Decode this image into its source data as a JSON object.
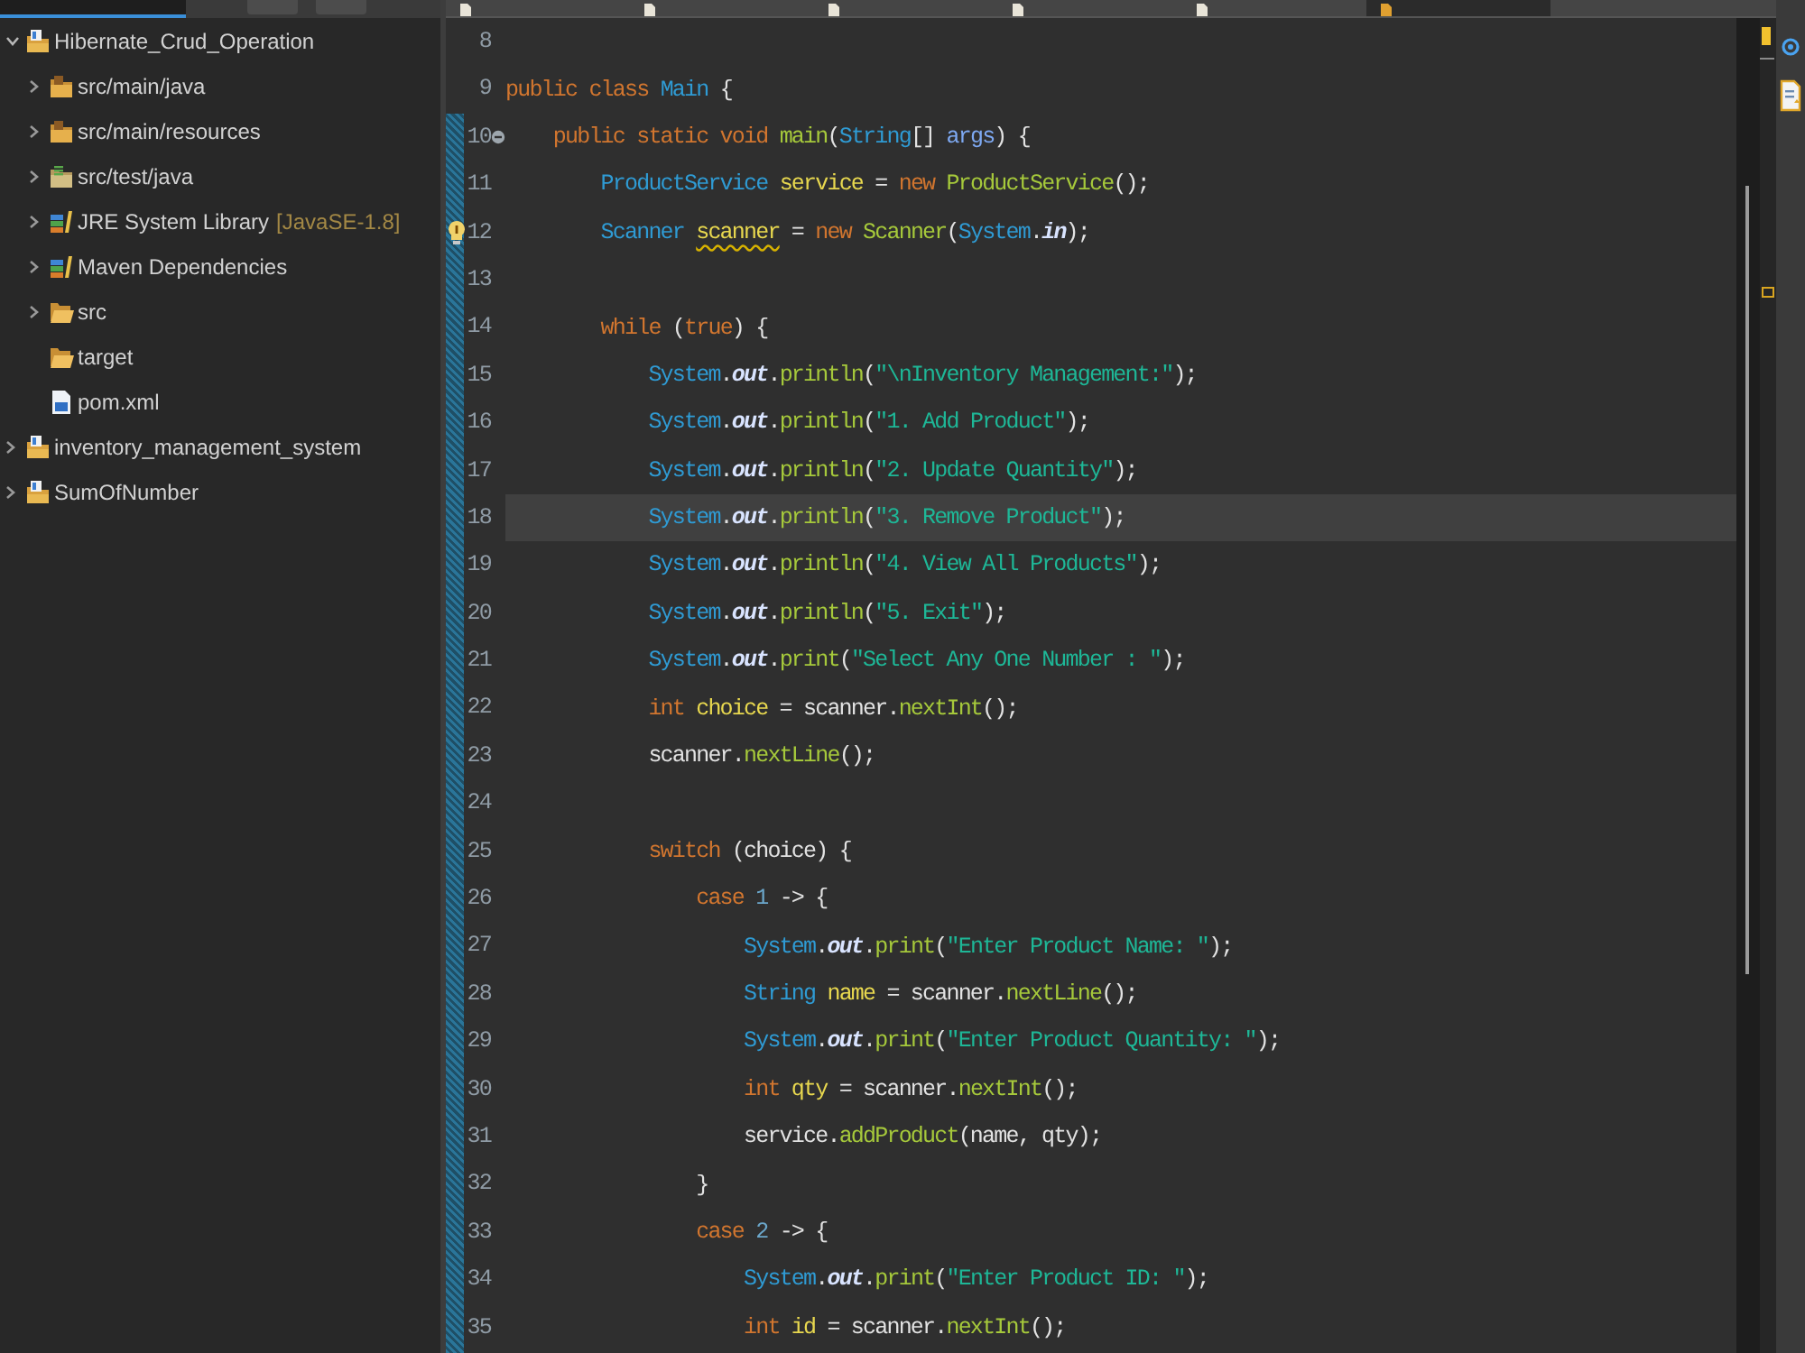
{
  "view_tabs": [
    {
      "selected": true
    }
  ],
  "project_tree": [
    {
      "name": "Hibernate_Crud_Operation",
      "kind": "project",
      "expandable": true,
      "expanded": true,
      "children": [
        {
          "name": "src/main/java",
          "kind": "source-folder",
          "expandable": true,
          "expanded": false
        },
        {
          "name": "src/main/resources",
          "kind": "source-folder",
          "expandable": true,
          "expanded": false
        },
        {
          "name": "src/test/java",
          "kind": "test-folder",
          "expandable": true,
          "expanded": false
        },
        {
          "name": "JRE System Library",
          "decoration": "[JavaSE-1.8]",
          "kind": "library",
          "expandable": true,
          "expanded": false
        },
        {
          "name": "Maven Dependencies",
          "kind": "library",
          "expandable": true,
          "expanded": false
        },
        {
          "name": "src",
          "kind": "folder",
          "expandable": true,
          "expanded": false
        },
        {
          "name": "target",
          "kind": "folder",
          "expandable": false
        },
        {
          "name": "pom.xml",
          "kind": "maven-file",
          "expandable": false
        }
      ]
    },
    {
      "name": "inventory_management_system",
      "kind": "project",
      "expandable": true,
      "expanded": false
    },
    {
      "name": "SumOfNumber",
      "kind": "project",
      "expandable": true,
      "expanded": false
    }
  ],
  "editor": {
    "tabs": [
      {
        "selected": false
      },
      {
        "selected": false
      },
      {
        "selected": false
      },
      {
        "selected": false
      },
      {
        "selected": false
      },
      {
        "selected": true
      }
    ],
    "lines": [
      {
        "number": "8",
        "current": false
      },
      {
        "number": "9",
        "tokens": [
          {
            "text": "public class ",
            "kind": "keyword"
          },
          {
            "text": "Main",
            "kind": "type"
          },
          {
            "text": " {",
            "kind": "plain"
          }
        ],
        "current": false,
        "children": [
          {
            "number": "10",
            "foldable": true,
            "tokens": [
              {
                "text": "public static void ",
                "kind": "keyword"
              },
              {
                "text": "main",
                "kind": "method"
              },
              {
                "text": "(",
                "kind": "plain"
              },
              {
                "text": "String",
                "kind": "type"
              },
              {
                "text": "[] ",
                "kind": "plain"
              },
              {
                "text": "args",
                "kind": "parameter"
              },
              {
                "text": ") {",
                "kind": "plain"
              }
            ],
            "current": false,
            "children": [
              {
                "number": "11",
                "tokens": [
                  {
                    "text": "ProductService ",
                    "kind": "type"
                  },
                  {
                    "text": "service",
                    "kind": "declaration"
                  },
                  {
                    "text": " = ",
                    "kind": "plain"
                  },
                  {
                    "text": "new ",
                    "kind": "keyword"
                  },
                  {
                    "text": "ProductService",
                    "kind": "method"
                  },
                  {
                    "text": "();",
                    "kind": "plain"
                  }
                ],
                "current": false
              },
              {
                "number": "12",
                "warning": true,
                "tokens": [
                  {
                    "text": "Scanner ",
                    "kind": "type"
                  },
                  {
                    "text": "scanner",
                    "kind": "warning-declaration"
                  },
                  {
                    "text": " = ",
                    "kind": "plain"
                  },
                  {
                    "text": "new ",
                    "kind": "keyword"
                  },
                  {
                    "text": "Scanner",
                    "kind": "method"
                  },
                  {
                    "text": "(",
                    "kind": "plain"
                  },
                  {
                    "text": "System",
                    "kind": "type"
                  },
                  {
                    "text": ".",
                    "kind": "plain"
                  },
                  {
                    "text": "in",
                    "kind": "field"
                  },
                  {
                    "text": ");",
                    "kind": "plain"
                  }
                ],
                "current": false
              },
              {
                "number": "13",
                "current": false
              },
              {
                "number": "14",
                "tokens": [
                  {
                    "text": "while ",
                    "kind": "keyword"
                  },
                  {
                    "text": "(",
                    "kind": "plain"
                  },
                  {
                    "text": "true",
                    "kind": "keyword"
                  },
                  {
                    "text": ") {",
                    "kind": "plain"
                  }
                ],
                "current": false,
                "children": [
                  {
                    "number": "15",
                    "tokens": [
                      {
                        "text": "System",
                        "kind": "type"
                      },
                      {
                        "text": ".",
                        "kind": "plain"
                      },
                      {
                        "text": "out",
                        "kind": "field"
                      },
                      {
                        "text": ".",
                        "kind": "plain"
                      },
                      {
                        "text": "println",
                        "kind": "method"
                      },
                      {
                        "text": "(",
                        "kind": "plain"
                      },
                      {
                        "text": "\"\\nInventory Management:\"",
                        "kind": "string"
                      },
                      {
                        "text": ");",
                        "kind": "plain"
                      }
                    ],
                    "current": false
                  },
                  {
                    "number": "16",
                    "tokens": [
                      {
                        "text": "System",
                        "kind": "type"
                      },
                      {
                        "text": ".",
                        "kind": "plain"
                      },
                      {
                        "text": "out",
                        "kind": "field"
                      },
                      {
                        "text": ".",
                        "kind": "plain"
                      },
                      {
                        "text": "println",
                        "kind": "method"
                      },
                      {
                        "text": "(",
                        "kind": "plain"
                      },
                      {
                        "text": "\"1. Add Product\"",
                        "kind": "string"
                      },
                      {
                        "text": ");",
                        "kind": "plain"
                      }
                    ],
                    "current": false
                  },
                  {
                    "number": "17",
                    "tokens": [
                      {
                        "text": "System",
                        "kind": "type"
                      },
                      {
                        "text": ".",
                        "kind": "plain"
                      },
                      {
                        "text": "out",
                        "kind": "field"
                      },
                      {
                        "text": ".",
                        "kind": "plain"
                      },
                      {
                        "text": "println",
                        "kind": "method"
                      },
                      {
                        "text": "(",
                        "kind": "plain"
                      },
                      {
                        "text": "\"2. Update Quantity\"",
                        "kind": "string"
                      },
                      {
                        "text": ");",
                        "kind": "plain"
                      }
                    ],
                    "current": false
                  },
                  {
                    "number": "18",
                    "tokens": [
                      {
                        "text": "System",
                        "kind": "type"
                      },
                      {
                        "text": ".",
                        "kind": "plain"
                      },
                      {
                        "text": "out",
                        "kind": "field"
                      },
                      {
                        "text": ".",
                        "kind": "plain"
                      },
                      {
                        "text": "println",
                        "kind": "method"
                      },
                      {
                        "text": "(",
                        "kind": "plain"
                      },
                      {
                        "text": "\"3. Remove Product\"",
                        "kind": "string"
                      },
                      {
                        "text": ");",
                        "kind": "plain"
                      }
                    ],
                    "current": true
                  },
                  {
                    "number": "19",
                    "tokens": [
                      {
                        "text": "System",
                        "kind": "type"
                      },
                      {
                        "text": ".",
                        "kind": "plain"
                      },
                      {
                        "text": "out",
                        "kind": "field"
                      },
                      {
                        "text": ".",
                        "kind": "plain"
                      },
                      {
                        "text": "println",
                        "kind": "method"
                      },
                      {
                        "text": "(",
                        "kind": "plain"
                      },
                      {
                        "text": "\"4. View All Products\"",
                        "kind": "string"
                      },
                      {
                        "text": ");",
                        "kind": "plain"
                      }
                    ],
                    "current": false
                  },
                  {
                    "number": "20",
                    "tokens": [
                      {
                        "text": "System",
                        "kind": "type"
                      },
                      {
                        "text": ".",
                        "kind": "plain"
                      },
                      {
                        "text": "out",
                        "kind": "field"
                      },
                      {
                        "text": ".",
                        "kind": "plain"
                      },
                      {
                        "text": "println",
                        "kind": "method"
                      },
                      {
                        "text": "(",
                        "kind": "plain"
                      },
                      {
                        "text": "\"5. Exit\"",
                        "kind": "string"
                      },
                      {
                        "text": ");",
                        "kind": "plain"
                      }
                    ],
                    "current": false
                  },
                  {
                    "number": "21",
                    "tokens": [
                      {
                        "text": "System",
                        "kind": "type"
                      },
                      {
                        "text": ".",
                        "kind": "plain"
                      },
                      {
                        "text": "out",
                        "kind": "field"
                      },
                      {
                        "text": ".",
                        "kind": "plain"
                      },
                      {
                        "text": "print",
                        "kind": "method"
                      },
                      {
                        "text": "(",
                        "kind": "plain"
                      },
                      {
                        "text": "\"Select Any One Number : \"",
                        "kind": "string"
                      },
                      {
                        "text": ");",
                        "kind": "plain"
                      }
                    ],
                    "current": false
                  },
                  {
                    "number": "22",
                    "tokens": [
                      {
                        "text": "int ",
                        "kind": "keyword"
                      },
                      {
                        "text": "choice",
                        "kind": "declaration"
                      },
                      {
                        "text": " = scanner.",
                        "kind": "plain"
                      },
                      {
                        "text": "nextInt",
                        "kind": "method"
                      },
                      {
                        "text": "();",
                        "kind": "plain"
                      }
                    ],
                    "current": false
                  },
                  {
                    "number": "23",
                    "tokens": [
                      {
                        "text": "scanner.",
                        "kind": "plain"
                      },
                      {
                        "text": "nextLine",
                        "kind": "method"
                      },
                      {
                        "text": "();",
                        "kind": "plain"
                      }
                    ],
                    "current": false
                  },
                  {
                    "number": "24",
                    "current": false
                  },
                  {
                    "number": "25",
                    "tokens": [
                      {
                        "text": "switch ",
                        "kind": "keyword"
                      },
                      {
                        "text": "(choice) {",
                        "kind": "plain"
                      }
                    ],
                    "current": false,
                    "children": [
                      {
                        "number": "26",
                        "tokens": [
                          {
                            "text": "case ",
                            "kind": "keyword"
                          },
                          {
                            "text": "1",
                            "kind": "number"
                          },
                          {
                            "text": " -> {",
                            "kind": "plain"
                          }
                        ],
                        "current": false,
                        "children": [
                          {
                            "number": "27",
                            "tokens": [
                              {
                                "text": "System",
                                "kind": "type"
                              },
                              {
                                "text": ".",
                                "kind": "plain"
                              },
                              {
                                "text": "out",
                                "kind": "field"
                              },
                              {
                                "text": ".",
                                "kind": "plain"
                              },
                              {
                                "text": "print",
                                "kind": "method"
                              },
                              {
                                "text": "(",
                                "kind": "plain"
                              },
                              {
                                "text": "\"Enter Product Name: \"",
                                "kind": "string"
                              },
                              {
                                "text": ");",
                                "kind": "plain"
                              }
                            ],
                            "current": false
                          },
                          {
                            "number": "28",
                            "tokens": [
                              {
                                "text": "String ",
                                "kind": "type"
                              },
                              {
                                "text": "name",
                                "kind": "declaration"
                              },
                              {
                                "text": " = scanner.",
                                "kind": "plain"
                              },
                              {
                                "text": "nextLine",
                                "kind": "method"
                              },
                              {
                                "text": "();",
                                "kind": "plain"
                              }
                            ],
                            "current": false
                          },
                          {
                            "number": "29",
                            "tokens": [
                              {
                                "text": "System",
                                "kind": "type"
                              },
                              {
                                "text": ".",
                                "kind": "plain"
                              },
                              {
                                "text": "out",
                                "kind": "field"
                              },
                              {
                                "text": ".",
                                "kind": "plain"
                              },
                              {
                                "text": "print",
                                "kind": "method"
                              },
                              {
                                "text": "(",
                                "kind": "plain"
                              },
                              {
                                "text": "\"Enter Product Quantity: \"",
                                "kind": "string"
                              },
                              {
                                "text": ");",
                                "kind": "plain"
                              }
                            ],
                            "current": false
                          },
                          {
                            "number": "30",
                            "tokens": [
                              {
                                "text": "int ",
                                "kind": "keyword"
                              },
                              {
                                "text": "qty",
                                "kind": "declaration"
                              },
                              {
                                "text": " = scanner.",
                                "kind": "plain"
                              },
                              {
                                "text": "nextInt",
                                "kind": "method"
                              },
                              {
                                "text": "();",
                                "kind": "plain"
                              }
                            ],
                            "current": false
                          },
                          {
                            "number": "31",
                            "tokens": [
                              {
                                "text": "service.",
                                "kind": "plain"
                              },
                              {
                                "text": "addProduct",
                                "kind": "method"
                              },
                              {
                                "text": "(name, qty);",
                                "kind": "plain"
                              }
                            ],
                            "current": false
                          }
                        ]
                      },
                      {
                        "number": "32",
                        "tokens": [
                          {
                            "text": "}",
                            "kind": "plain"
                          }
                        ],
                        "current": false
                      },
                      {
                        "number": "33",
                        "tokens": [
                          {
                            "text": "case ",
                            "kind": "keyword"
                          },
                          {
                            "text": "2",
                            "kind": "number"
                          },
                          {
                            "text": " -> {",
                            "kind": "plain"
                          }
                        ],
                        "current": false,
                        "children": [
                          {
                            "number": "34",
                            "tokens": [
                              {
                                "text": "System",
                                "kind": "type"
                              },
                              {
                                "text": ".",
                                "kind": "plain"
                              },
                              {
                                "text": "out",
                                "kind": "field"
                              },
                              {
                                "text": ".",
                                "kind": "plain"
                              },
                              {
                                "text": "print",
                                "kind": "method"
                              },
                              {
                                "text": "(",
                                "kind": "plain"
                              },
                              {
                                "text": "\"Enter Product ID: \"",
                                "kind": "string"
                              },
                              {
                                "text": ");",
                                "kind": "plain"
                              }
                            ],
                            "current": false
                          },
                          {
                            "number": "35",
                            "tokens": [
                              {
                                "text": "int ",
                                "kind": "keyword"
                              },
                              {
                                "text": "id",
                                "kind": "declaration"
                              },
                              {
                                "text": " = scanner.",
                                "kind": "plain"
                              },
                              {
                                "text": "nextInt",
                                "kind": "method"
                              },
                              {
                                "text": "();",
                                "kind": "plain"
                              }
                            ],
                            "current": false
                          }
                        ]
                      }
                    ]
                  }
                ]
              }
            ]
          }
        ]
      }
    ]
  }
}
